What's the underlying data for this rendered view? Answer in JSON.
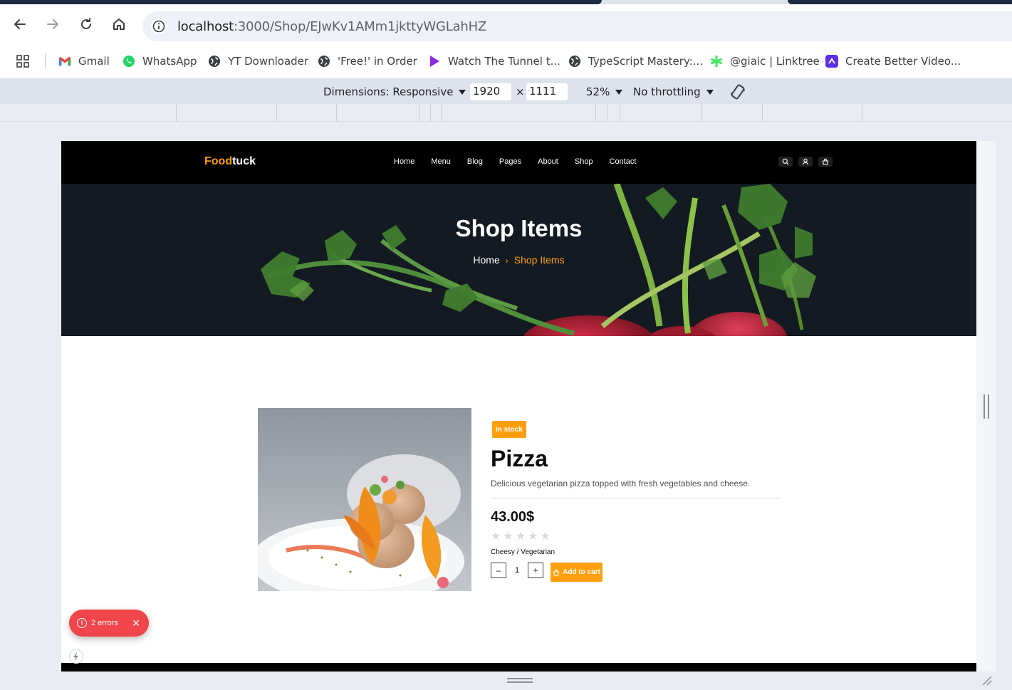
{
  "browser": {
    "url_host": "localhost",
    "url_path": ":3000/Shop/EJwKv1AMm1jkttyWGLahHZ",
    "bookmarks": [
      {
        "label": "Gmail",
        "icon": "gmail-icon"
      },
      {
        "label": "WhatsApp",
        "icon": "whatsapp-icon"
      },
      {
        "label": "YT Downloader",
        "icon": "globe-icon"
      },
      {
        "label": "'Free!' in Order",
        "icon": "globe-icon"
      },
      {
        "label": "Watch The Tunnel t...",
        "icon": "play-icon"
      },
      {
        "label": "TypeScript Mastery:...",
        "icon": "globe-icon"
      },
      {
        "label": "@giaic | Linktree",
        "icon": "linktree-icon"
      },
      {
        "label": "Create Better Video...",
        "icon": "video-app-icon"
      }
    ]
  },
  "devtools": {
    "dimensions_label": "Dimensions: Responsive",
    "width": "1920",
    "times": "×",
    "height": "1111",
    "zoom": "52%",
    "throttling": "No throttling"
  },
  "site": {
    "logo_accent": "Food",
    "logo_rest": "tuck",
    "nav": [
      "Home",
      "Menu",
      "Blog",
      "Pages",
      "About",
      "Shop",
      "Contact"
    ],
    "hero_title": "Shop Items",
    "breadcrumb_home": "Home",
    "breadcrumb_sep": "›",
    "breadcrumb_current": "Shop Items"
  },
  "product": {
    "stock_badge": "In stock",
    "name": "Pizza",
    "description": "Delicious vegetarian pizza topped with fresh vegetables and cheese.",
    "price": "43.00$",
    "rating": 0,
    "rating_max": 5,
    "tags": "Cheesy / Vegetarian",
    "quantity": "1",
    "minus": "–",
    "plus": "+",
    "add_to_cart": "Add to cart"
  },
  "dev_overlay": {
    "errors_label": "2 errors"
  },
  "colors": {
    "accent": "#ff9f0d",
    "error": "#f0454a"
  }
}
